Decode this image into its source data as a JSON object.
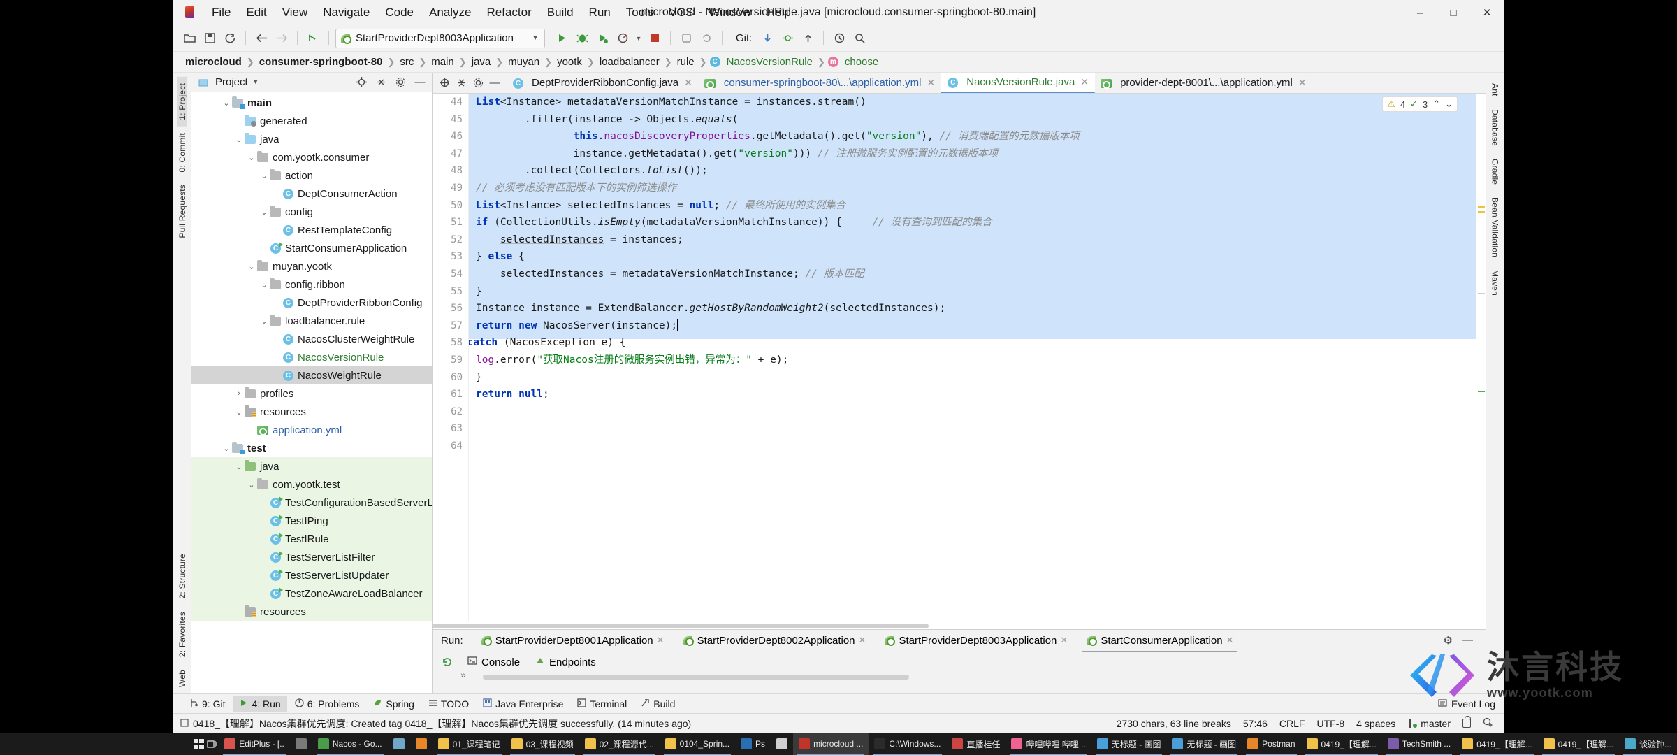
{
  "window": {
    "title": "microcloud - NacosVersionRule.java [microcloud.consumer-springboot-80.main]",
    "minimize": "–",
    "maximize": "□",
    "close": "✕"
  },
  "menu": [
    "File",
    "Edit",
    "View",
    "Navigate",
    "Code",
    "Analyze",
    "Refactor",
    "Build",
    "Run",
    "Tools",
    "VCS",
    "Window",
    "Help"
  ],
  "toolbar": {
    "run_config": "StartProviderDept8003Application",
    "git_label": "Git:",
    "dropdown_caret": "▼"
  },
  "breadcrumbs": [
    {
      "text": "microcloud",
      "bold": true,
      "icon": ""
    },
    {
      "text": "consumer-springboot-80",
      "bold": true,
      "icon": ""
    },
    {
      "text": "src",
      "bold": false,
      "icon": ""
    },
    {
      "text": "main",
      "bold": false,
      "icon": ""
    },
    {
      "text": "java",
      "bold": false,
      "icon": ""
    },
    {
      "text": "muyan",
      "bold": false,
      "icon": ""
    },
    {
      "text": "yootk",
      "bold": false,
      "icon": ""
    },
    {
      "text": "loadbalancer",
      "bold": false,
      "icon": ""
    },
    {
      "text": "rule",
      "bold": false,
      "icon": ""
    },
    {
      "text": "NacosVersionRule",
      "bold": false,
      "icon": "class-badge"
    },
    {
      "text": "choose",
      "bold": false,
      "icon": "method-badge"
    }
  ],
  "left_strip": [
    "1: Project",
    "0: Commit",
    "Pull Requests"
  ],
  "right_strip": [
    "Ant",
    "Database",
    "Gradle",
    "Bean Validation",
    "Maven"
  ],
  "left_bottom_strip": [
    "2: Structure",
    "2: Favorites",
    "Web"
  ],
  "project_panel": {
    "title": "Project",
    "title_caret": "▼",
    "tree": [
      {
        "depth": 2,
        "arrow": "v",
        "icon": "module-folder",
        "label": "main",
        "bold": true,
        "style": "plain"
      },
      {
        "depth": 3,
        "arrow": "",
        "icon": "generated-folder",
        "label": "generated",
        "bold": false,
        "style": "plain"
      },
      {
        "depth": 3,
        "arrow": "v",
        "icon": "blue-folder",
        "label": "java",
        "bold": false,
        "style": "plain"
      },
      {
        "depth": 4,
        "arrow": "v",
        "icon": "package",
        "label": "com.yootk.consumer",
        "bold": false,
        "style": "plain"
      },
      {
        "depth": 5,
        "arrow": "v",
        "icon": "package",
        "label": "action",
        "bold": false,
        "style": "plain"
      },
      {
        "depth": 6,
        "arrow": "",
        "icon": "class",
        "label": "DeptConsumerAction",
        "bold": false,
        "style": "plain"
      },
      {
        "depth": 5,
        "arrow": "v",
        "icon": "package",
        "label": "config",
        "bold": false,
        "style": "plain"
      },
      {
        "depth": 6,
        "arrow": "",
        "icon": "class",
        "label": "RestTemplateConfig",
        "bold": false,
        "style": "plain"
      },
      {
        "depth": 5,
        "arrow": "",
        "icon": "class-run",
        "label": "StartConsumerApplication",
        "bold": false,
        "style": "plain"
      },
      {
        "depth": 4,
        "arrow": "v",
        "icon": "package",
        "label": "muyan.yootk",
        "bold": false,
        "style": "plain"
      },
      {
        "depth": 5,
        "arrow": "v",
        "icon": "package",
        "label": "config.ribbon",
        "bold": false,
        "style": "plain"
      },
      {
        "depth": 6,
        "arrow": "",
        "icon": "class",
        "label": "DeptProviderRibbonConfig",
        "bold": false,
        "style": "plain"
      },
      {
        "depth": 5,
        "arrow": "v",
        "icon": "package",
        "label": "loadbalancer.rule",
        "bold": false,
        "style": "plain"
      },
      {
        "depth": 6,
        "arrow": "",
        "icon": "class",
        "label": "NacosClusterWeightRule",
        "bold": false,
        "style": "plain"
      },
      {
        "depth": 6,
        "arrow": "",
        "icon": "class",
        "label": "NacosVersionRule",
        "bold": false,
        "style": "green"
      },
      {
        "depth": 6,
        "arrow": "",
        "icon": "class",
        "label": "NacosWeightRule",
        "bold": false,
        "style": "selected"
      },
      {
        "depth": 3,
        "arrow": ">",
        "icon": "gray-folder",
        "label": "profiles",
        "bold": false,
        "style": "plain"
      },
      {
        "depth": 3,
        "arrow": "v",
        "icon": "resource-folder",
        "label": "resources",
        "bold": false,
        "style": "plain"
      },
      {
        "depth": 4,
        "arrow": "",
        "icon": "yml",
        "label": "application.yml",
        "bold": false,
        "style": "blue"
      },
      {
        "depth": 2,
        "arrow": "v",
        "icon": "test-module-folder",
        "label": "test",
        "bold": true,
        "style": "plain"
      },
      {
        "depth": 3,
        "arrow": "v",
        "icon": "green-folder",
        "label": "java",
        "bold": false,
        "style": "test"
      },
      {
        "depth": 4,
        "arrow": "v",
        "icon": "package",
        "label": "com.yootk.test",
        "bold": false,
        "style": "test"
      },
      {
        "depth": 5,
        "arrow": "",
        "icon": "class-run",
        "label": "TestConfigurationBasedServerList",
        "bold": false,
        "style": "test"
      },
      {
        "depth": 5,
        "arrow": "",
        "icon": "class-run",
        "label": "TestIPing",
        "bold": false,
        "style": "test"
      },
      {
        "depth": 5,
        "arrow": "",
        "icon": "class-run",
        "label": "TestIRule",
        "bold": false,
        "style": "test"
      },
      {
        "depth": 5,
        "arrow": "",
        "icon": "class-run",
        "label": "TestServerListFilter",
        "bold": false,
        "style": "test"
      },
      {
        "depth": 5,
        "arrow": "",
        "icon": "class-run",
        "label": "TestServerListUpdater",
        "bold": false,
        "style": "test"
      },
      {
        "depth": 5,
        "arrow": "",
        "icon": "class-run",
        "label": "TestZoneAwareLoadBalancer",
        "bold": false,
        "style": "test"
      },
      {
        "depth": 3,
        "arrow": "",
        "icon": "resource-folder",
        "label": "resources",
        "bold": false,
        "style": "test"
      }
    ]
  },
  "editor_tabs": [
    {
      "label": "DeptProviderRibbonConfig.java",
      "icon": "class",
      "color": "plain",
      "active": false,
      "close": "✕"
    },
    {
      "label": "consumer-springboot-80\\...\\application.yml",
      "icon": "yml",
      "color": "blue",
      "active": false,
      "close": "✕"
    },
    {
      "label": "NacosVersionRule.java",
      "icon": "class",
      "color": "green",
      "active": true,
      "close": "✕"
    },
    {
      "label": "provider-dept-8001\\...\\application.yml",
      "icon": "yml",
      "color": "plain",
      "active": false,
      "close": "✕"
    }
  ],
  "inspection_widget": {
    "warning_icon": "⚠",
    "warning_count": "4",
    "weak_icon": "✓",
    "weak_count": "3",
    "up": "⌃",
    "down": "⌄"
  },
  "code": {
    "first_line_number": 44,
    "line_numbers": [
      44,
      45,
      46,
      47,
      48,
      49,
      50,
      51,
      52,
      53,
      54,
      55,
      56,
      57,
      58,
      59,
      60,
      61,
      62,
      63,
      64
    ],
    "lines": [
      "            List<Instance> metadataVersionMatchInstance = instances.stream()",
      "                    .filter(instance -> Objects.equals(",
      "                            this.nacosDiscoveryProperties.getMetadata().get(\"version\"), // 消费端配置的元数据版本项",
      "                            instance.getMetadata().get(\"version\"))) // 注册微服务实例配置的元数据版本项",
      "                    .collect(Collectors.toList());",
      "            // 必须考虑没有匹配版本下的实例筛选操作",
      "            List<Instance> selectedInstances = null; // 最终所使用的实例集合",
      "            if (CollectionUtils.isEmpty(metadataVersionMatchInstance) {     // 没有查询到匹配的集合",
      "                selectedInstances = instances;",
      "            } else {",
      "                selectedInstances = metadataVersionMatchInstance; // 版本匹配",
      "            }",
      "            Instance instance = ExtendBalancer.getHostByRandomWeight2(selectedInstances);",
      "            return new NacosServer(instance);",
      "        } catch (NacosException e) {",
      "            log.error(\"获取Nacos注册的微服务实例出错，异常为：\" + e);",
      "        }",
      "        return null;",
      "    }",
      "}",
      ""
    ]
  },
  "run_panel": {
    "caption": "Run:",
    "tabs": [
      {
        "label": "StartProviderDept8001Application",
        "active": false,
        "close": "✕"
      },
      {
        "label": "StartProviderDept8002Application",
        "active": false,
        "close": "✕"
      },
      {
        "label": "StartProviderDept8003Application",
        "active": false,
        "close": "✕"
      },
      {
        "label": "StartConsumerApplication",
        "active": true,
        "close": "✕"
      }
    ],
    "sub_tabs": [
      {
        "label": "Console",
        "icon": "console-icon",
        "active": true
      },
      {
        "label": "Endpoints",
        "icon": "endpoints-icon",
        "active": false
      }
    ],
    "settings_icon": "⚙",
    "hide_icon": "—",
    "overflow_icon": "»"
  },
  "tool_window_bar": [
    {
      "label": "9: Git",
      "icon": "git-icon",
      "selected": false
    },
    {
      "label": "4: Run",
      "icon": "run-icon",
      "selected": true
    },
    {
      "label": "6: Problems",
      "icon": "problems-icon",
      "selected": false
    },
    {
      "label": "Spring",
      "icon": "spring-icon",
      "selected": false
    },
    {
      "label": "TODO",
      "icon": "todo-icon",
      "selected": false
    },
    {
      "label": "Java Enterprise",
      "icon": "java-enterprise-icon",
      "selected": false
    },
    {
      "label": "Terminal",
      "icon": "terminal-icon",
      "selected": false
    },
    {
      "label": "Build",
      "icon": "build-icon",
      "selected": false
    }
  ],
  "event_log": {
    "label": "Event Log",
    "icon": "event-log-icon"
  },
  "status_bar": {
    "message": "0418_【理解】Nacos集群优先调度: Created tag 0418_【理解】Nacos集群优先调度 successfully. (14 minutes ago)",
    "chars": "2730 chars, 63 line breaks",
    "caret_position": "57:46",
    "line_separator": "CRLF",
    "encoding": "UTF-8",
    "indent": "4 spaces",
    "branch": "master",
    "lock_icon": "lock-icon",
    "inspection_icon": "inspection-icon"
  },
  "watermark": {
    "company_cn": "沐言科技",
    "url": "www.yootk.com"
  },
  "taskbar": {
    "start_icon": "windows-start-icon",
    "taskview_icon": "task-view-icon",
    "items": [
      {
        "label": "EditPlus - [..",
        "color": "#d9534f",
        "active": false,
        "running": true
      },
      {
        "label": "",
        "color": "#7a7a7a",
        "active": false,
        "running": false
      },
      {
        "label": "Nacos - Go...",
        "color": "#4a9e4a",
        "active": false,
        "running": true
      },
      {
        "label": "",
        "color": "#6fa8c9",
        "active": false,
        "running": false
      },
      {
        "label": "",
        "color": "#e8862a",
        "active": false,
        "running": false
      },
      {
        "label": "01_课程笔记",
        "color": "#f0c24b",
        "active": false,
        "running": true
      },
      {
        "label": "03_课程视频",
        "color": "#f0c24b",
        "active": false,
        "running": true
      },
      {
        "label": "02_课程源代...",
        "color": "#f0c24b",
        "active": false,
        "running": true
      },
      {
        "label": "0104_Sprin...",
        "color": "#f0c24b",
        "active": false,
        "running": true
      },
      {
        "label": "Ps",
        "color": "#2a6fb0",
        "active": false,
        "running": false
      },
      {
        "label": "",
        "color": "#d0d0d0",
        "active": false,
        "running": false
      },
      {
        "label": "microcloud ...",
        "color": "#c1342c",
        "active": true,
        "running": true
      },
      {
        "label": "C:\\Windows...",
        "color": "#2b2b2b",
        "active": false,
        "running": true
      },
      {
        "label": "直播桂任",
        "color": "#c44",
        "active": false,
        "running": false
      },
      {
        "label": "哔哩哔哩 哔哩...",
        "color": "#f06292",
        "active": false,
        "running": true
      },
      {
        "label": "无标题 - 画图",
        "color": "#4a9ed9",
        "active": false,
        "running": true
      },
      {
        "label": "无标题 - 画图",
        "color": "#4a9ed9",
        "active": false,
        "running": true
      },
      {
        "label": "Postman",
        "color": "#e8862a",
        "active": false,
        "running": true
      },
      {
        "label": "0419_【理解...",
        "color": "#f0c24b",
        "active": false,
        "running": true
      },
      {
        "label": "TechSmith ...",
        "color": "#7a5ca8",
        "active": false,
        "running": true
      },
      {
        "label": "0419_【理解...",
        "color": "#f0c24b",
        "active": false,
        "running": true
      },
      {
        "label": "0419_【理解...",
        "color": "#f0c24b",
        "active": false,
        "running": true
      },
      {
        "label": "谈验钟...",
        "color": "#4aa8c9",
        "active": false,
        "running": true
      }
    ]
  }
}
